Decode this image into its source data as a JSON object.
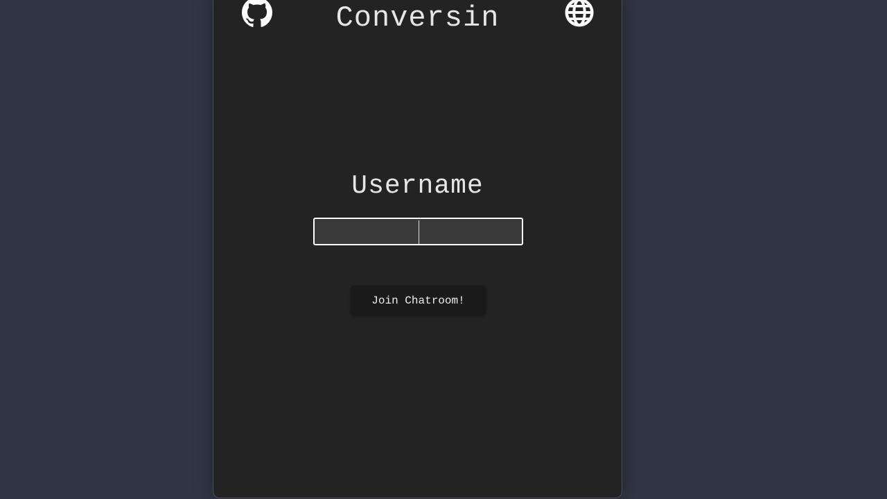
{
  "app": {
    "title": "Conversin"
  },
  "header": {
    "left_icon": "github-icon",
    "right_icon": "globe-icon"
  },
  "login": {
    "label": "Username",
    "input": {
      "value": "",
      "placeholder": ""
    },
    "join_button_label": "Join Chatroom!"
  },
  "colors": {
    "background": "#323544",
    "card": "#232323",
    "input_bg": "#3a3a3a",
    "button_bg": "#1a1a1a",
    "text": "#e6e6e6"
  }
}
